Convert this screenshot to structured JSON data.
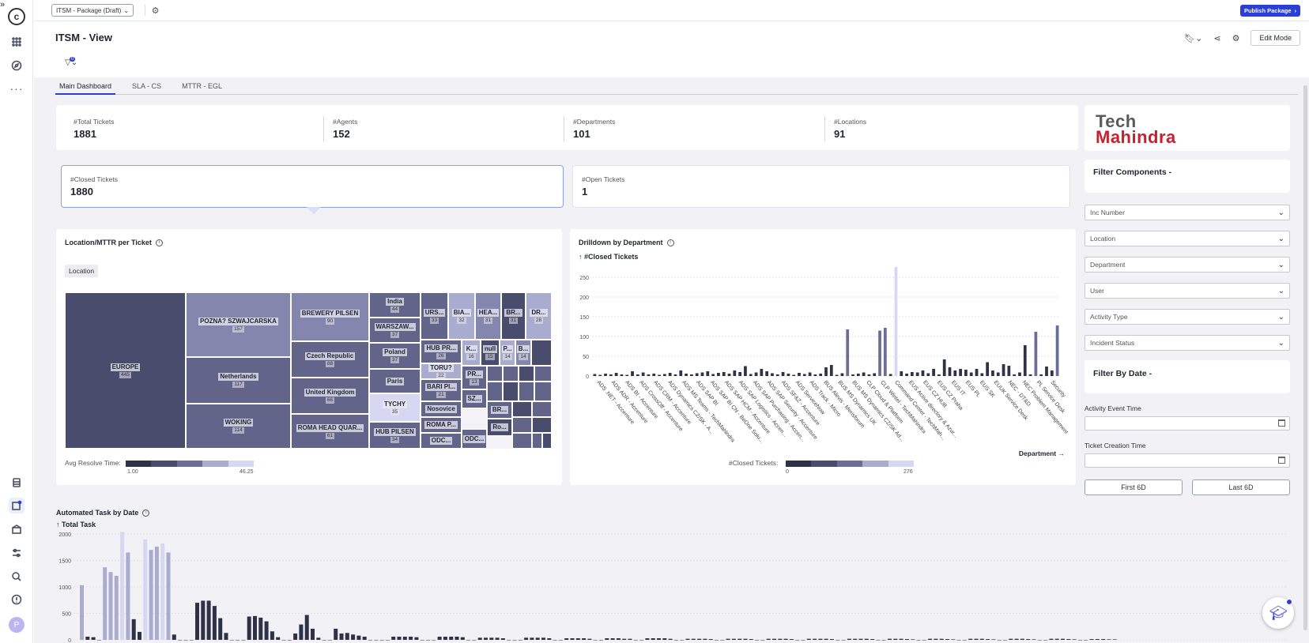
{
  "topbar": {
    "package_label": "ITSM - Package (Draft)",
    "publish_label": "Publish Package"
  },
  "header": {
    "title": "ITSM - View",
    "edit_mode_label": "Edit Mode",
    "filter_count": "0"
  },
  "tabs": [
    {
      "label": "Main Dashboard",
      "active": true
    },
    {
      "label": "SLA - CS",
      "active": false
    },
    {
      "label": "MTTR - EGL",
      "active": false
    }
  ],
  "kpis": [
    {
      "label": "#Total Tickets",
      "value": "1881"
    },
    {
      "label": "#Agents",
      "value": "152"
    },
    {
      "label": "#Departments",
      "value": "101"
    },
    {
      "label": "#Locations",
      "value": "91"
    }
  ],
  "closed": {
    "label": "#Closed Tickets",
    "value": "1880"
  },
  "open": {
    "label": "#Open Tickets",
    "value": "1"
  },
  "location_panel": {
    "title": "Location/MTTR per Ticket",
    "chip": "Location",
    "legend_label": "Avg Resolve Time:",
    "legend_min": "1.00",
    "legend_max": "46.25",
    "cells": [
      {
        "name": "EUROPE",
        "value": "445",
        "shade": 0
      },
      {
        "name": "POZNA? SZWAJCARSKA",
        "value": "157",
        "shade": 2
      },
      {
        "name": "Netherlands",
        "value": "117",
        "shade": 1
      },
      {
        "name": "WOKING",
        "value": "114",
        "shade": 1
      },
      {
        "name": "BREWERY PILSEN",
        "value": "90",
        "shade": 2
      },
      {
        "name": "Czech Republic",
        "value": "88",
        "shade": 1
      },
      {
        "name": "United Kingdom",
        "value": "66",
        "shade": 1
      },
      {
        "name": "ROMA HEAD QUAR...",
        "value": "61",
        "shade": 1
      },
      {
        "name": "India",
        "value": "44",
        "shade": 1
      },
      {
        "name": "WARSZAW...",
        "value": "37",
        "shade": 1
      },
      {
        "name": "Poland",
        "value": "37",
        "shade": 1
      },
      {
        "name": "TYCHY",
        "value": "35",
        "shade": 4
      },
      {
        "name": "HUB PILSEN",
        "value": "34",
        "shade": 1
      },
      {
        "name": "URS...",
        "value": "33",
        "shade": 1
      },
      {
        "name": "BIA...",
        "value": "32",
        "shade": 3
      },
      {
        "name": "HEA...",
        "value": "31",
        "shade": 2
      },
      {
        "name": "BR...",
        "value": "31",
        "shade": 0
      },
      {
        "name": "DR...",
        "value": "28",
        "shade": 3
      },
      {
        "name": "HUB PR...",
        "value": "26",
        "shade": 1
      },
      {
        "name": "TORU?",
        "value": "22",
        "shade": 3
      },
      {
        "name": "BARI PI...",
        "value": "21",
        "shade": 1
      },
      {
        "name": "Nosovice",
        "value": "",
        "shade": 1
      },
      {
        "name": "ROMA P...",
        "value": "",
        "shade": 1
      },
      {
        "name": "ODC...",
        "value": "",
        "shade": 1
      },
      {
        "name": "K...",
        "value": "16",
        "shade": 3
      },
      {
        "name": "null",
        "value": "15",
        "shade": 0
      },
      {
        "name": "P...",
        "value": "14",
        "shade": 3
      },
      {
        "name": "B...",
        "value": "14",
        "shade": 2
      },
      {
        "name": "PR...",
        "value": "13",
        "shade": 1
      },
      {
        "name": "SZ...",
        "value": "",
        "shade": 1
      },
      {
        "name": "BR...",
        "value": "",
        "shade": 1
      },
      {
        "name": "Ro...",
        "value": "",
        "shade": 0
      },
      {
        "name": "Paris",
        "value": "",
        "shade": 1
      },
      {
        "name": "ODC...",
        "value": "",
        "shade": 1
      }
    ]
  },
  "department_panel": {
    "title": "Drilldown by Department",
    "legend_label": "#Closed Tickets:",
    "legend_min": "0",
    "legend_max": "276",
    "x_link": "Department →"
  },
  "automated_panel": {
    "title": "Automated Task by Date"
  },
  "sidebar": {
    "logo_line1": "Tech",
    "logo_line2": "Mahindra",
    "filter_components": "Filter Components -",
    "dropdowns": [
      "Inc Number",
      "Location",
      "Department",
      "User",
      "Activity Type",
      "Incident Status"
    ],
    "filter_by_date": "Filter By Date -",
    "activity_event_time": "Activity Event Time",
    "ticket_creation_time": "Ticket Creation Time",
    "first_btn": "First 6D",
    "last_btn": "Last 6D"
  },
  "rail": {
    "avatar": "P"
  },
  "colors": {
    "accent": "#2b3fd6",
    "shades": [
      "#4a4c6e",
      "#626589",
      "#8486ad",
      "#a9abcf",
      "#d6d8f2"
    ]
  },
  "chart_data": [
    {
      "type": "bar",
      "title": "Drilldown by Department",
      "ylabel": "↑ #Closed Tickets",
      "xlabel": "Department",
      "ylim": [
        0,
        276
      ],
      "yticks": [
        0,
        50,
        100,
        150,
        200,
        250
      ],
      "categories": [
        "ADS .NET - Accenture",
        "ADS ADR - Accenture",
        "ADS BI - Accenture",
        "ADS CrossOff - Accenture",
        "ADS CRM - Accenture",
        "ADS Dynamics CZ/SK - A...",
        "ADS MS Teams - TechMahindra",
        "ADS SAP BI",
        "ADS SAP BI CN - BeOne Solu...",
        "ADS SAP HCM - Accenture",
        "ADS SAP Logistics - Accen...",
        "ADS SAP Purchasing - Accen...",
        "ADS SAP Security - Accenture",
        "ADS SF&Z - Accenture",
        "ADS ServiceNow",
        "ADS Track - Micro",
        "BUS Alevis - Merisforum",
        "BUS MS Dynamics UK",
        "BUS MS Dynamics CZ/SK Ad...",
        "CLP Cloud & Platform",
        "CLP Wintel - TechMahindra",
        "Command Center - TechMah...",
        "EUS Active directory & Azur...",
        "EUS CZ HUB",
        "EUS CZ Praha",
        "EUS IT",
        "EUS PL",
        "EUS SK",
        "EUUK Service Desk",
        "NEC - DT&D",
        "NEC Problem Management",
        "PL Service Desk",
        "Security"
      ],
      "values": [
        5,
        3,
        6,
        4,
        8,
        4,
        3,
        12,
        4,
        9,
        4,
        6,
        3,
        5,
        8,
        4,
        14,
        6,
        4,
        7,
        9,
        12,
        5,
        8,
        10,
        6,
        14,
        10,
        25,
        5,
        9,
        18,
        12,
        7,
        4,
        10,
        6,
        3,
        8,
        5,
        9,
        4,
        6,
        22,
        28,
        3,
        7,
        118,
        4,
        6,
        9,
        4,
        7,
        115,
        122,
        5,
        276,
        12,
        6,
        10,
        9,
        14,
        7,
        18,
        4,
        42,
        22,
        14,
        18,
        16,
        9,
        18,
        7,
        35,
        14,
        9,
        30,
        26,
        4,
        9,
        78,
        4,
        112,
        4,
        24,
        14,
        128
      ]
    },
    {
      "type": "bar",
      "title": "Automated Task by Date",
      "ylabel": "↑ Total Task",
      "ylim": [
        0,
        2000
      ],
      "yticks": [
        0,
        500,
        1000,
        1500,
        2000
      ],
      "values": [
        1030,
        60,
        50,
        0,
        1370,
        1280,
        1210,
        2040,
        1650,
        390,
        150,
        1900,
        1700,
        1760,
        1820,
        1650,
        100,
        0,
        0,
        0,
        700,
        740,
        740,
        640,
        410,
        130,
        0,
        0,
        0,
        440,
        450,
        420,
        350,
        160,
        50,
        0,
        0,
        120,
        290,
        470,
        210,
        40,
        0,
        0,
        210,
        120,
        130,
        100,
        80,
        60,
        0,
        0,
        0,
        0,
        60,
        60,
        60,
        60,
        50,
        0,
        0,
        0,
        60,
        60,
        60,
        60,
        50,
        0,
        0,
        40,
        40,
        40,
        40,
        30,
        0,
        0,
        0,
        40,
        40,
        40,
        40,
        30,
        0,
        0,
        30,
        30,
        30,
        30,
        20,
        0,
        0,
        30,
        30,
        30,
        20,
        20,
        0,
        0,
        30,
        30,
        30,
        30,
        20,
        0,
        0,
        20,
        20,
        20,
        20,
        15,
        0,
        0,
        20,
        20,
        20,
        20,
        15,
        0,
        0,
        20,
        20,
        20,
        20,
        15,
        0,
        0,
        20,
        20,
        20,
        20,
        15,
        0,
        0,
        20,
        20,
        20,
        20,
        15,
        0,
        0,
        20,
        20,
        20,
        15,
        10,
        0,
        0,
        20,
        20,
        20,
        15,
        10,
        0,
        0,
        20,
        20,
        20,
        15,
        10,
        0,
        0,
        20,
        20,
        20,
        15,
        10,
        0,
        0,
        20,
        20,
        20,
        15,
        10,
        0,
        0,
        15,
        15,
        15,
        10,
        10
      ]
    }
  ]
}
